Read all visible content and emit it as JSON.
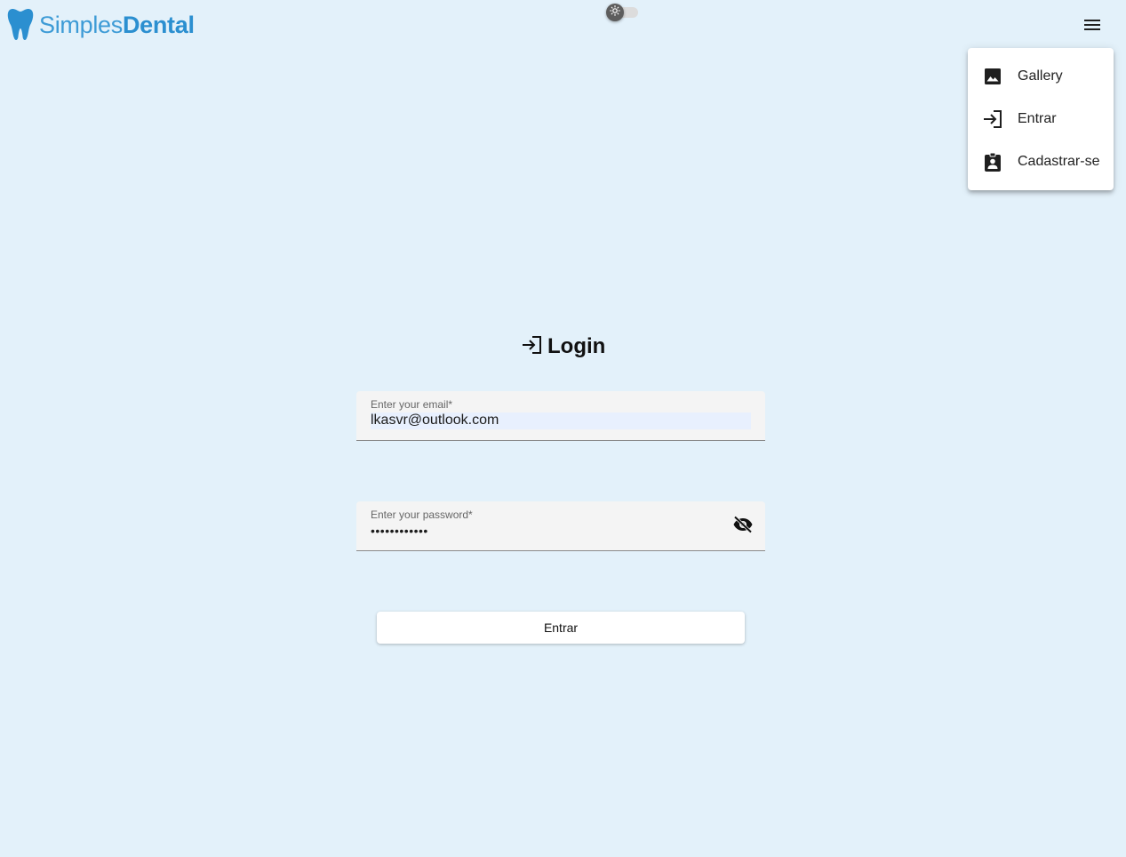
{
  "header": {
    "brand_light": "Simples",
    "brand_bold": "Dental",
    "logo_icon": "tooth-icon",
    "theme_toggle_icon": "sun-icon",
    "theme_toggle_state": "light",
    "menu_icon": "hamburger-menu-icon"
  },
  "menu": {
    "items": [
      {
        "label": "Gallery",
        "icon": "image-icon"
      },
      {
        "label": "Entrar",
        "icon": "login-icon"
      },
      {
        "label": "Cadastrar-se",
        "icon": "assignment-ind-icon"
      }
    ]
  },
  "login": {
    "title": "Login",
    "title_icon": "login-icon",
    "email_label": "Enter your email*",
    "email_value": "lkasvr@outlook.com",
    "password_label": "Enter your password*",
    "password_value": "••••••••••••",
    "password_visibility_icon": "visibility-off-icon",
    "submit_label": "Entrar"
  },
  "colors": {
    "background": "#e3f1fa",
    "brand_blue": "#2b8fd0",
    "field_background": "#f4f4f4",
    "autofill_background": "#e8f0fe"
  }
}
